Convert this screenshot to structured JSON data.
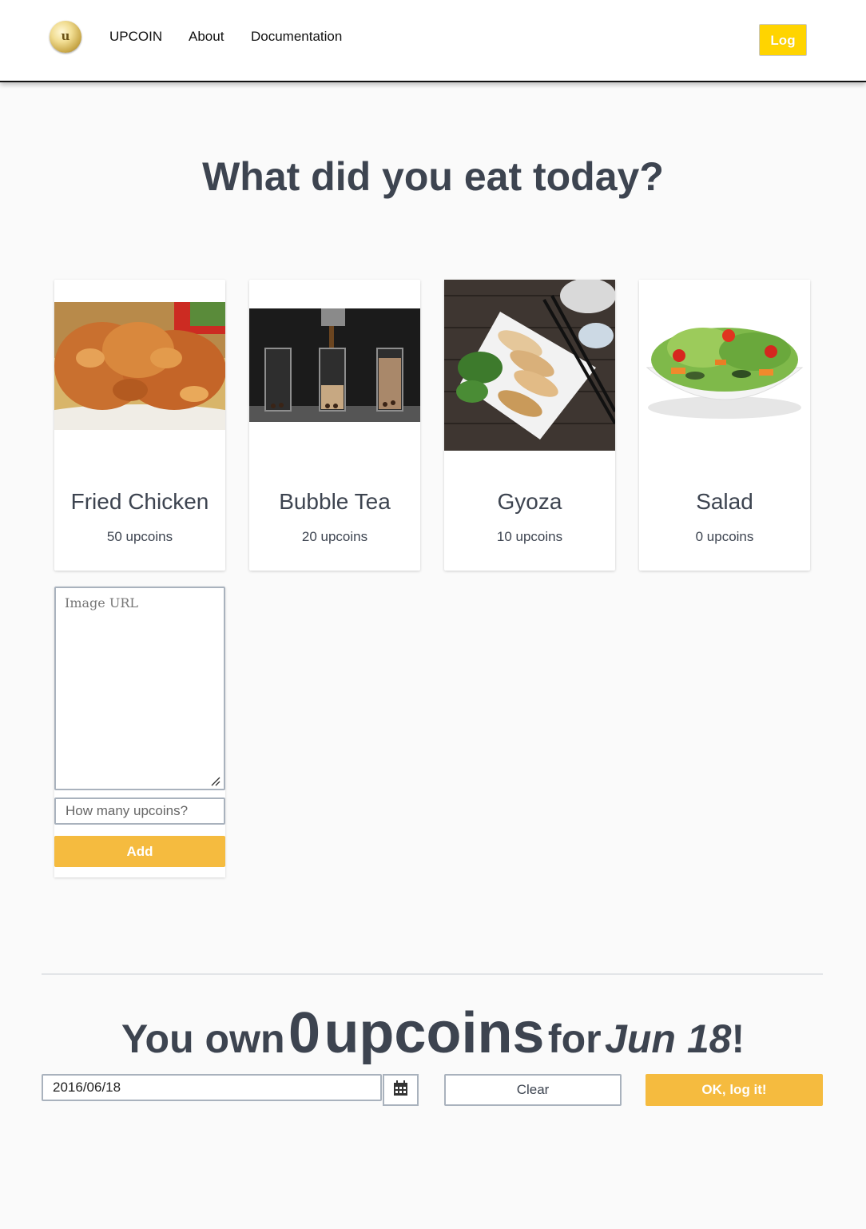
{
  "nav": {
    "logo_text": "u",
    "links": [
      "UPCOIN",
      "About",
      "Documentation"
    ],
    "log_button": "Log",
    "log_color": "#ffd400"
  },
  "main": {
    "title": "What did you eat today?"
  },
  "foods": [
    {
      "name": "Fried Chicken",
      "price": "50 upcoins",
      "image": "fried-chicken-photo"
    },
    {
      "name": "Bubble Tea",
      "price": "20 upcoins",
      "image": "bubble-tea-photo"
    },
    {
      "name": "Gyoza",
      "price": "10 upcoins",
      "image": "gyoza-photo"
    },
    {
      "name": "Salad",
      "price": "0 upcoins",
      "image": "salad-photo"
    }
  ],
  "add_form": {
    "image_url_placeholder": "Image URL",
    "upcoins_placeholder": "How many upcoins?",
    "add_button": "Add"
  },
  "summary": {
    "prefix": "You own",
    "amount": "0",
    "unit": "upcoins",
    "for_word": "for",
    "date": "Jun 18",
    "suffix": "!"
  },
  "log_form": {
    "date_value": "2016/06/18",
    "calendar_icon": "calendar-icon",
    "clear_button": "Clear",
    "ok_button": "OK, log it!"
  },
  "colors": {
    "accent": "#f5bb3f",
    "nav_button": "#ffd400",
    "text": "#3d4450"
  }
}
